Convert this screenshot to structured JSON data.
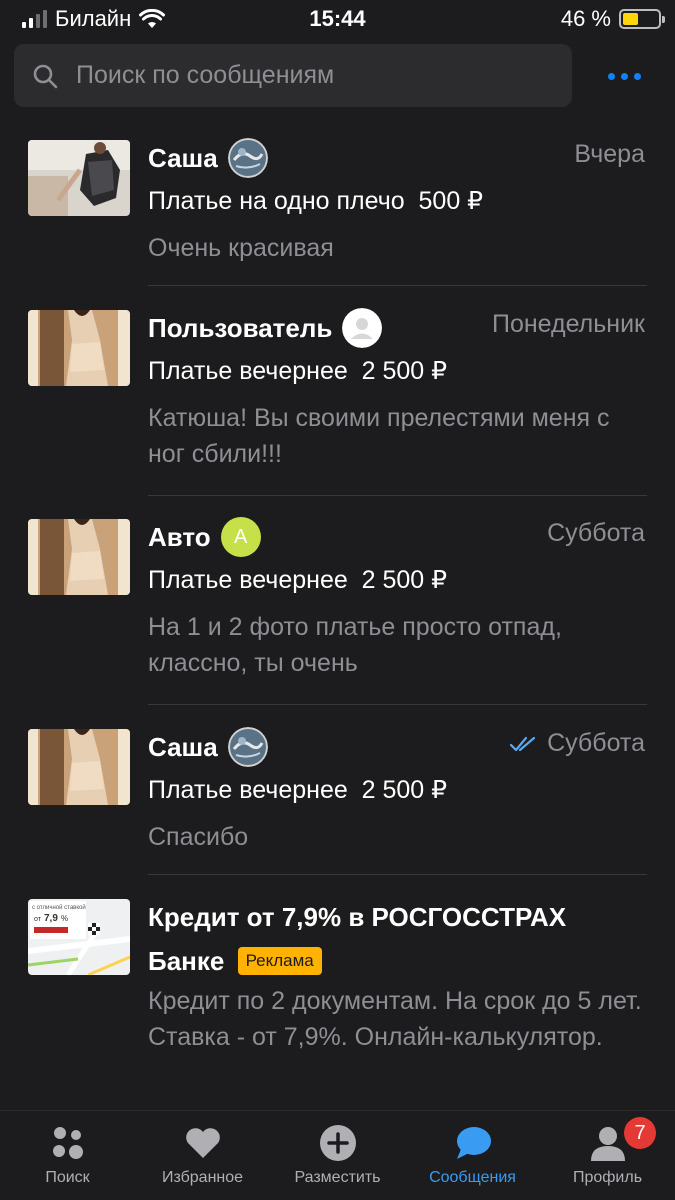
{
  "status_bar": {
    "carrier": "Билайн",
    "time": "15:44",
    "battery": "46 %"
  },
  "search": {
    "placeholder": "Поиск по сообщениям"
  },
  "conversations": [
    {
      "name": "Саша",
      "date": "Вчера",
      "title": "Платье на одно плечо  500 ₽",
      "preview": "Очень красивая",
      "avatar": "globe-avatar",
      "read_receipt": false
    },
    {
      "name": "Пользователь",
      "date": "Понедельник",
      "title": "Платье вечернее  2 500 ₽",
      "preview": "Катюша! Вы своими прелестями меня с ног сбили!!!",
      "avatar": "default-user-avatar",
      "read_receipt": false
    },
    {
      "name": "Авто",
      "date": "Суббота",
      "title": "Платье вечернее  2 500 ₽",
      "preview": "На 1 и 2 фото платье  просто отпад, классно,  ты очень",
      "avatar": "letter-avatar",
      "avatar_letter": "А",
      "read_receipt": false
    },
    {
      "name": "Саша",
      "date": "Суббота",
      "title": "Платье вечернее  2 500 ₽",
      "preview": "Спасибо",
      "avatar": "globe-avatar",
      "read_receipt": true
    }
  ],
  "ad": {
    "title": "Кредит от 7,9% в РОСГОССТРАХ Банке",
    "badge": "Реклама",
    "preview": "Кредит по 2 документам. На срок до 5 лет. Ставка - от 7,9%. Онлайн-калькулятор.",
    "thumb_caption": "с отличной ставкой",
    "thumb_rate_prefix": "от",
    "thumb_rate": "7,9",
    "thumb_rate_unit": "%"
  },
  "tabs": [
    {
      "label": "Поиск",
      "icon": "search-dots-icon",
      "active": false
    },
    {
      "label": "Избранное",
      "icon": "heart-icon",
      "active": false
    },
    {
      "label": "Разместить",
      "icon": "plus-circle-icon",
      "active": false
    },
    {
      "label": "Сообщения",
      "icon": "chat-bubble-icon",
      "active": true
    },
    {
      "label": "Профиль",
      "icon": "profile-icon",
      "active": false,
      "badge": "7"
    }
  ],
  "colors": {
    "background": "#1c1c1e",
    "accent": "#0a84ff",
    "ad_badge": "#ffb300",
    "notification_badge": "#e53935",
    "letter_avatar": "#c6e04a"
  }
}
